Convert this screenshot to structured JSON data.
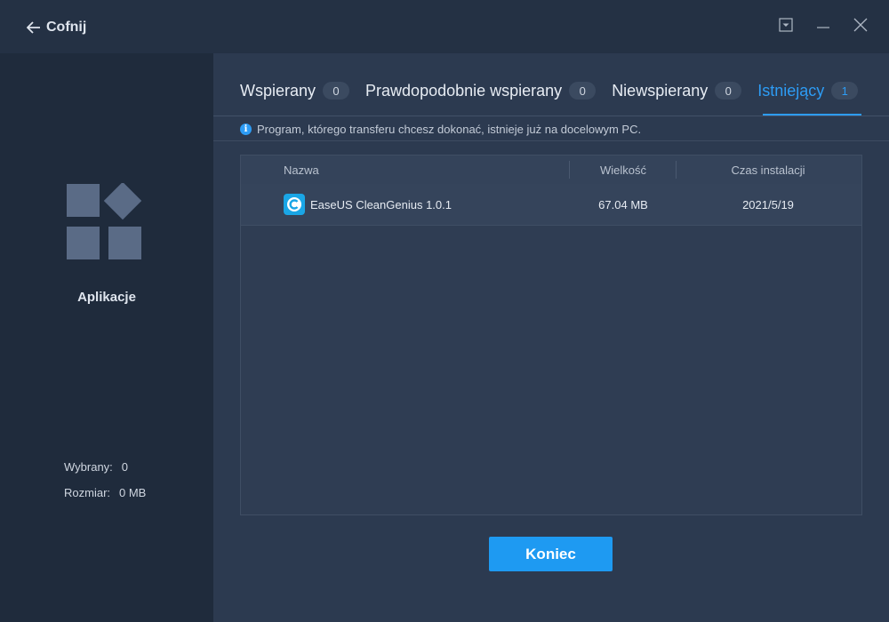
{
  "titlebar": {
    "back_label": "Cofnij"
  },
  "sidebar": {
    "category_label": "Aplikacje",
    "selected_label": "Wybrany:",
    "selected_value": "0",
    "size_label": "Rozmiar:",
    "size_value": "0 MB"
  },
  "tabs": [
    {
      "label": "Wspierany",
      "count": "0"
    },
    {
      "label": "Prawdopodobnie wspierany",
      "count": "0"
    },
    {
      "label": "Niewspierany",
      "count": "0"
    },
    {
      "label": "Istniejący",
      "count": "1"
    }
  ],
  "info_text": "Program, którego transferu chcesz dokonać, istnieje już na docelowym PC.",
  "table": {
    "columns": [
      "Nazwa",
      "Wielkość",
      "Czas instalacji"
    ],
    "rows": [
      {
        "name": "EaseUS CleanGenius 1.0.1",
        "size": "67.04 MB",
        "install_date": "2021/5/19"
      }
    ]
  },
  "finish_button": "Koniec",
  "colors": {
    "accent": "#1e9af2",
    "active_tab": "#2d9cf5",
    "background": "#2c3a50",
    "sidebar": "#1f2b3c"
  }
}
